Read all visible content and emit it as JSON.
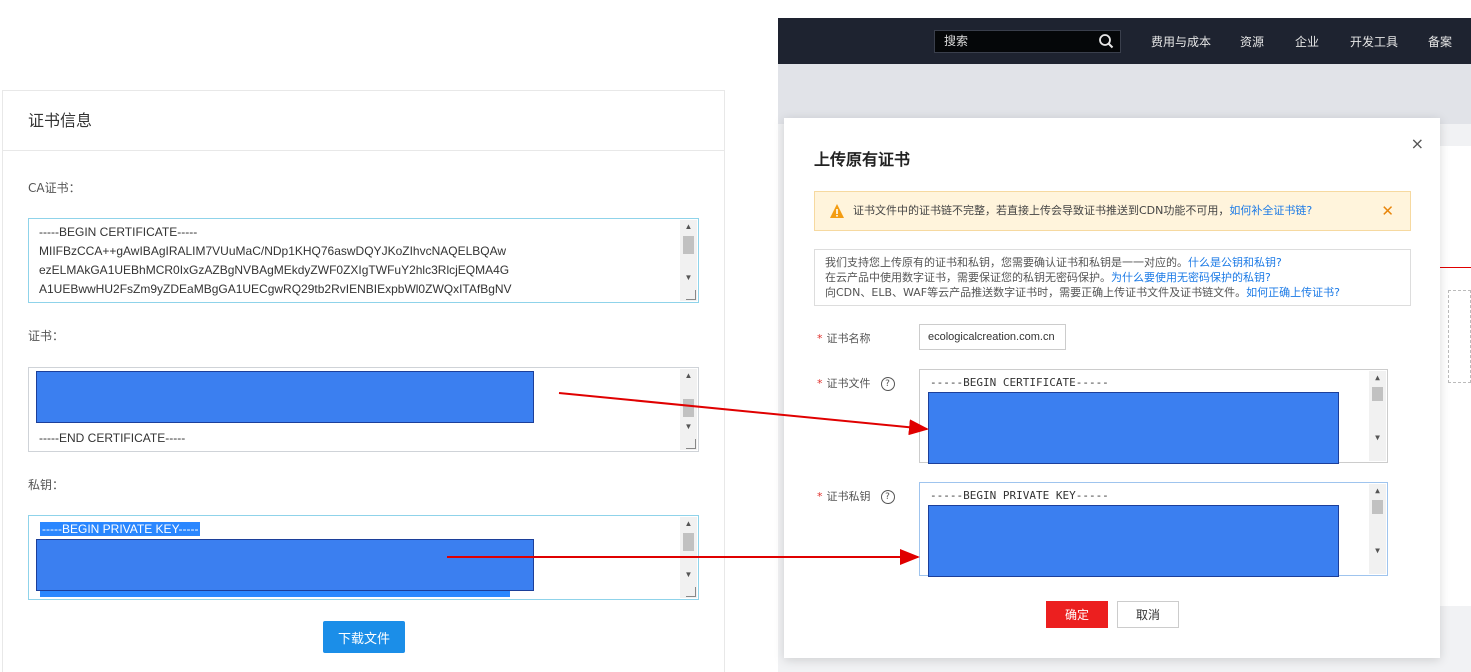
{
  "left": {
    "title": "证书信息",
    "ca_label": "CA证书：",
    "ca_lines": [
      "-----BEGIN CERTIFICATE-----",
      "MIIFBzCCA++gAwIBAgIRALIM7VUuMaC/NDp1KHQ76aswDQYJKoZIhvcNAQELBQAw",
      "ezELMAkGA1UEBhMCR0IxGzAZBgNVBAgMEkdyZWF0ZXIgTWFuY2hlc3RlcjEQMA4G",
      "A1UEBwwHU2FsZm9yZDEaMBgGA1UECgwRQ29tb2RvIENBIExpbWl0ZWQxITAfBgNV"
    ],
    "cert_label": "证书：",
    "cert_end": "-----END CERTIFICATE-----",
    "key_label": "私钥：",
    "key_begin": "-----BEGIN PRIVATE KEY-----",
    "download_label": "下载文件"
  },
  "console": {
    "search_placeholder": "搜索",
    "nav": [
      "费用与成本",
      "资源",
      "企业",
      "开发工具",
      "备案"
    ]
  },
  "modal": {
    "title": "上传原有证书",
    "close": "×",
    "warning_text": "证书文件中的证书链不完整，若直接上传会导致证书推送到CDN功能不可用，",
    "warning_link": "如何补全证书链?",
    "info": [
      {
        "text": "我们支持您上传原有的证书和私钥，您需要确认证书和私钥是一一对应的。",
        "link": "什么是公钥和私钥?"
      },
      {
        "text": "在云产品中使用数字证书，需要保证您的私钥无密码保护。",
        "link": "为什么要使用无密码保护的私钥?"
      },
      {
        "text": "向CDN、ELB、WAF等云产品推送数字证书时，需要正确上传证书文件及证书链文件。",
        "link": "如何正确上传证书?"
      }
    ],
    "name_label": "证书名称",
    "name_value": "ecologicalcreation.com.cn",
    "file_label": "证书文件",
    "file_begin": "-----BEGIN CERTIFICATE-----",
    "key_label": "证书私钥",
    "key_begin": "-----BEGIN PRIVATE KEY-----",
    "ok_label": "确定",
    "cancel_label": "取消"
  },
  "colors": {
    "accent_blue": "#1b8ee8",
    "redaction": "#3b7ff0",
    "confirm_red": "#ec1f1f",
    "arrow_red": "#e00000"
  }
}
